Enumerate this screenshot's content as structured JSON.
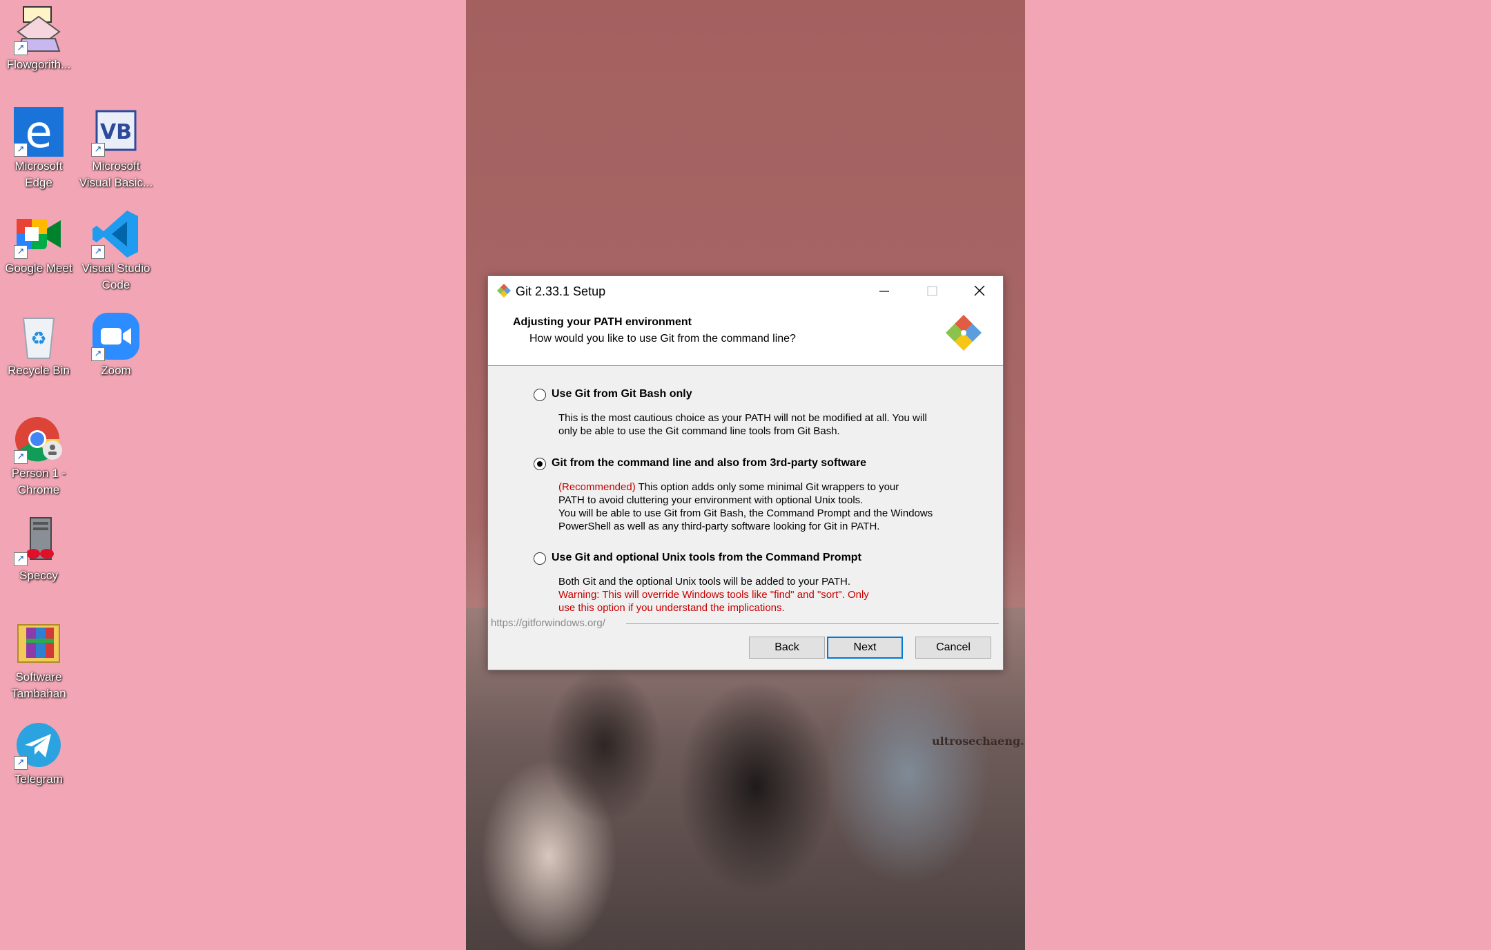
{
  "desktop": {
    "icons": [
      {
        "label": "Flowgorith...",
        "icon": "flowgorithm-icon"
      },
      {
        "label": "Microsoft Edge",
        "icon": "edge-icon"
      },
      {
        "label": "Microsoft Visual Basic...",
        "icon": "visual-basic-icon"
      },
      {
        "label": "Google Meet",
        "icon": "google-meet-icon"
      },
      {
        "label": "Visual Studio Code",
        "icon": "vscode-icon"
      },
      {
        "label": "Recycle Bin",
        "icon": "recycle-bin-icon"
      },
      {
        "label": "Zoom",
        "icon": "zoom-icon"
      },
      {
        "label": "Person 1 - Chrome",
        "icon": "chrome-icon"
      },
      {
        "label": "Speccy",
        "icon": "speccy-icon"
      },
      {
        "label": "Software Tambahan",
        "icon": "winrar-folder-icon"
      },
      {
        "label": "Telegram",
        "icon": "telegram-icon"
      }
    ]
  },
  "wallpaper": {
    "watermark": "ultrosechaeng."
  },
  "dialog": {
    "title": "Git 2.33.1 Setup",
    "heading": "Adjusting your PATH environment",
    "subheading": "How would you like to use Git from the command line?",
    "options": [
      {
        "label": "Use Git from Git Bash only",
        "selected": false,
        "desc1": "This is the most cautious choice as your PATH will not be modified at all. You will",
        "desc2": "only be able to use the Git command line tools from Git Bash."
      },
      {
        "label": "Git from the command line and also from 3rd-party software",
        "selected": true,
        "tag": "(Recommended)",
        "desc1": " This option adds only some minimal Git wrappers to your",
        "desc2": "PATH to avoid cluttering your environment with optional Unix tools.",
        "desc3": "You will be able to use Git from Git Bash, the Command Prompt and the Windows",
        "desc4": "PowerShell as well as any third-party software looking for Git in PATH."
      },
      {
        "label": "Use Git and optional Unix tools from the Command Prompt",
        "selected": false,
        "desc1": "Both Git and the optional Unix tools will be added to your PATH.",
        "warn1": "Warning: This will override Windows tools like \"find\" and \"sort\". Only",
        "warn2": "use this option if you understand the implications."
      }
    ],
    "url": "https://gitforwindows.org/",
    "buttons": {
      "back": "Back",
      "next": "Next",
      "cancel": "Cancel"
    }
  },
  "colors": {
    "desktop": "#f2a5b4",
    "warning": "#c80000",
    "focus": "#0078d7"
  }
}
